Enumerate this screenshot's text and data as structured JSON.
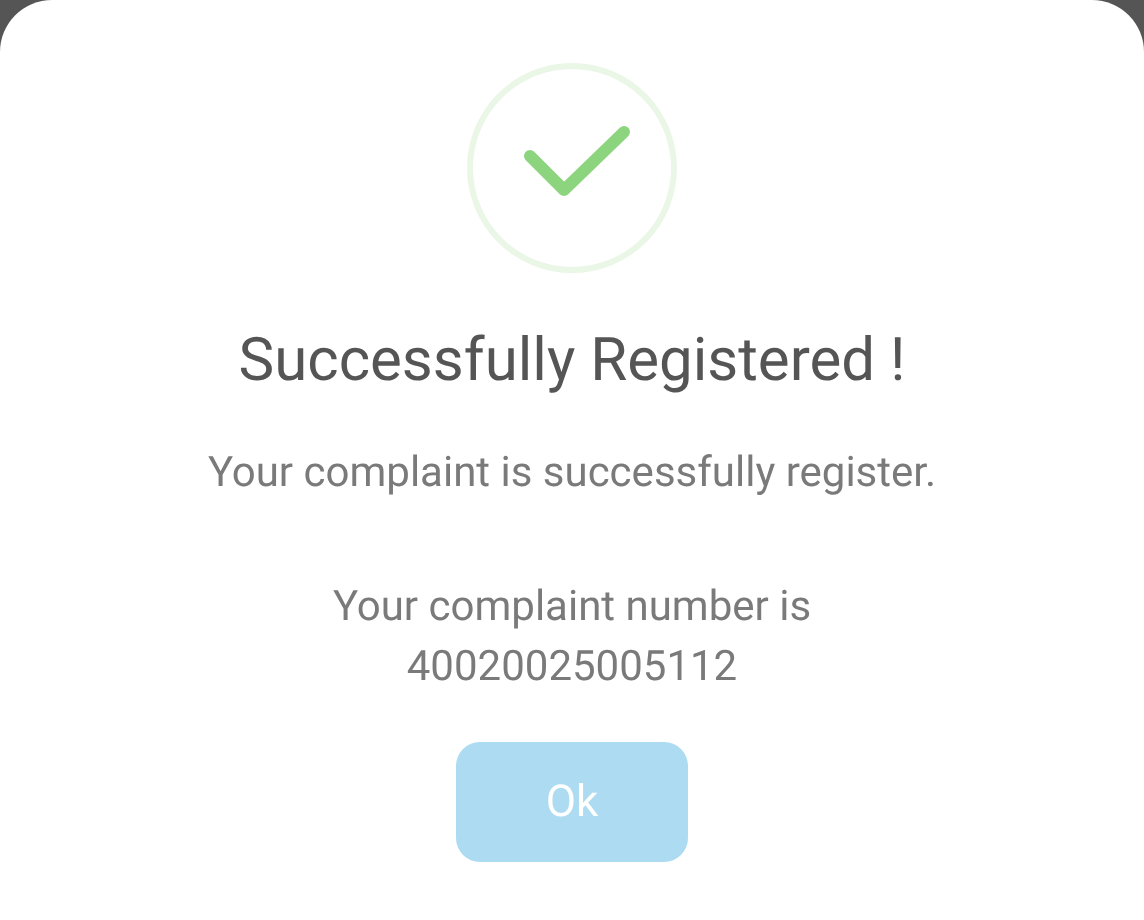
{
  "dialog": {
    "title": "Successfully Registered !",
    "message": "Your complaint is successfully register.",
    "number_label": "Your complaint number is",
    "number": "40020025005112",
    "button": "Ok"
  }
}
